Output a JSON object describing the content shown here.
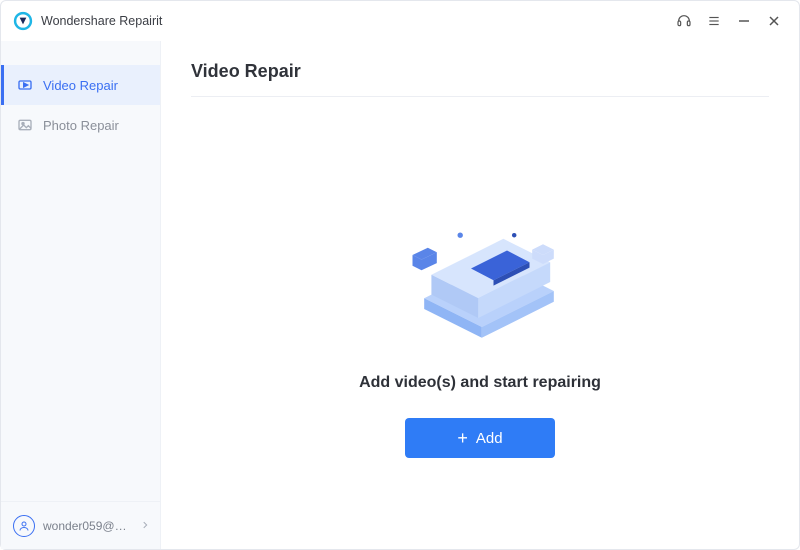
{
  "app": {
    "title": "Wondershare Repairit"
  },
  "sidebar": {
    "items": [
      {
        "label": "Video Repair",
        "active": true
      },
      {
        "label": "Photo Repair",
        "active": false
      }
    ],
    "account": {
      "label": "wonder059@16..."
    }
  },
  "main": {
    "page_title": "Video Repair",
    "blurb": "Add video(s) and start repairing",
    "add_button": "Add"
  }
}
